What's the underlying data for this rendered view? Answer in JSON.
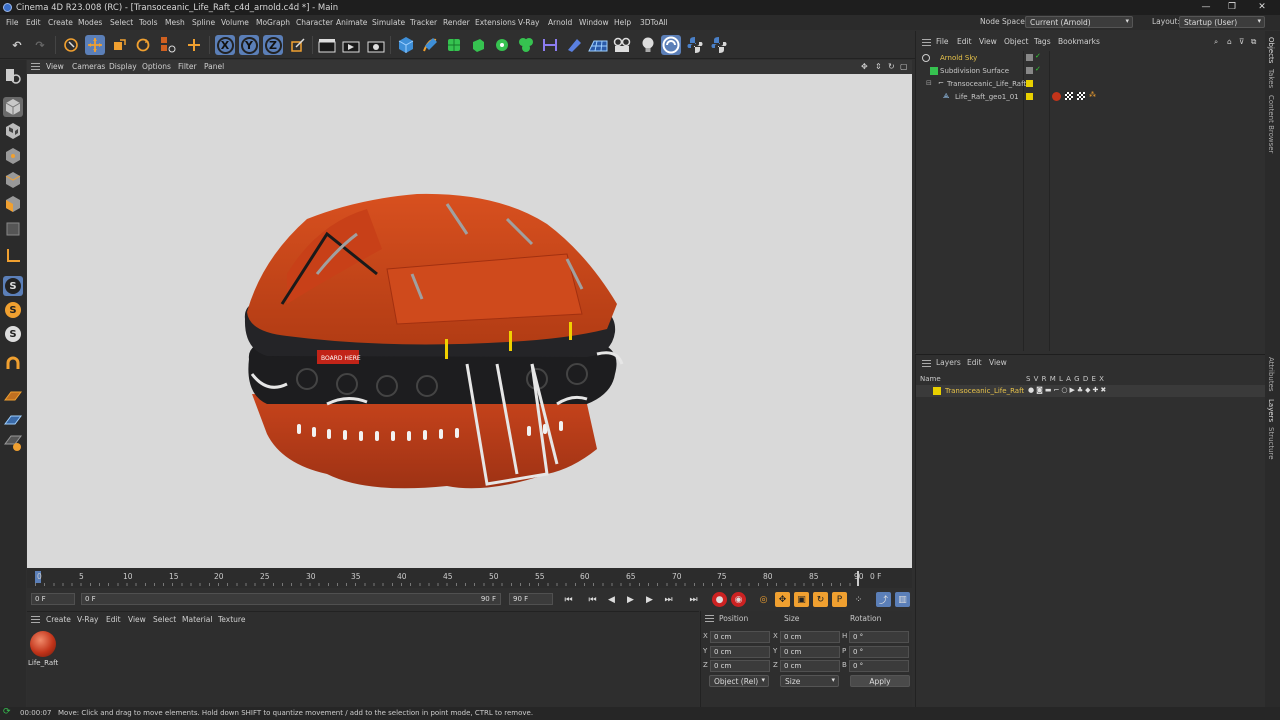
{
  "window": {
    "title": "Cinema 4D R23.008 (RC) - [Transoceanic_Life_Raft_c4d_arnold.c4d *] - Main",
    "minimize": "—",
    "maximize": "❐",
    "close": "✕"
  },
  "menubar": {
    "items": [
      "File",
      "Edit",
      "Create",
      "Modes",
      "Select",
      "Tools",
      "Mesh",
      "Spline",
      "Volume",
      "MoGraph",
      "Character",
      "Animate",
      "Simulate",
      "Tracker",
      "Render",
      "Extensions",
      "V-Ray",
      "Arnold",
      "Window",
      "Help",
      "3DToAll"
    ],
    "node_space_label": "Node Space:",
    "node_space_value": "Current (Arnold)",
    "layout_label": "Layout:",
    "layout_value": "Startup (User)"
  },
  "toolbar": {
    "axis_x": "X",
    "axis_y": "Y",
    "axis_z": "Z"
  },
  "left_tools": {
    "s1": "S",
    "s2": "S",
    "s3": "S"
  },
  "viewport_menu": {
    "items": [
      "View",
      "Cameras",
      "Display",
      "Options",
      "Filter",
      "Panel"
    ]
  },
  "viewport": {
    "decal_text": "BOARD HERE"
  },
  "timeline": {
    "ticks": [
      "0",
      "5",
      "10",
      "15",
      "20",
      "25",
      "30",
      "35",
      "40",
      "45",
      "50",
      "55",
      "60",
      "65",
      "70",
      "75",
      "80",
      "85",
      "90"
    ],
    "current_frame": "0 F"
  },
  "playbar": {
    "start_frame": "0 F",
    "current_frame": "0 F",
    "end_frame": "90 F",
    "end_frame2": "90 F"
  },
  "material_panel": {
    "menu": [
      "Create",
      "V-Ray",
      "Edit",
      "View",
      "Select",
      "Material",
      "Texture"
    ],
    "material_name": "Life_Raft"
  },
  "coordinates": {
    "headers": {
      "position": "Position",
      "size": "Size",
      "rotation": "Rotation"
    },
    "rows": [
      {
        "axis": "X",
        "pos": "0 cm",
        "size_axis": "X",
        "size": "0 cm",
        "rot_axis": "H",
        "rot": "0 °"
      },
      {
        "axis": "Y",
        "pos": "0 cm",
        "size_axis": "Y",
        "size": "0 cm",
        "rot_axis": "P",
        "rot": "0 °"
      },
      {
        "axis": "Z",
        "pos": "0 cm",
        "size_axis": "Z",
        "size": "0 cm",
        "rot_axis": "B",
        "rot": "0 °"
      }
    ],
    "mode": "Object (Rel)",
    "size_mode": "Size",
    "apply": "Apply"
  },
  "objects_panel": {
    "menu": [
      "File",
      "Edit",
      "View",
      "Object",
      "Tags",
      "Bookmarks"
    ],
    "items": [
      {
        "name": "Arnold Sky",
        "color": "#e8c34a"
      },
      {
        "name": "Subdivision Surface",
        "color": "#c8c8c8"
      },
      {
        "name": "Transoceanic_Life_Raft",
        "color": "#c8c8c8"
      },
      {
        "name": "Life_Raft_geo1_01",
        "color": "#c8c8c8"
      }
    ]
  },
  "layers_panel": {
    "menu": [
      "Layers",
      "Edit",
      "View"
    ],
    "col_name": "Name",
    "col_flags": "S V R M L A G D E X",
    "layer_name": "Transoceanic_Life_Raft",
    "layer_color": "#e8c34a"
  },
  "side_tabs": [
    "Objects",
    "Takes",
    "Content Browser",
    "Attributes",
    "Layers",
    "Structure"
  ],
  "status": {
    "time": "00:00:07",
    "message": "Move: Click and drag to move elements. Hold down SHIFT to quantize movement / add to the selection in point mode, CTRL to remove."
  }
}
